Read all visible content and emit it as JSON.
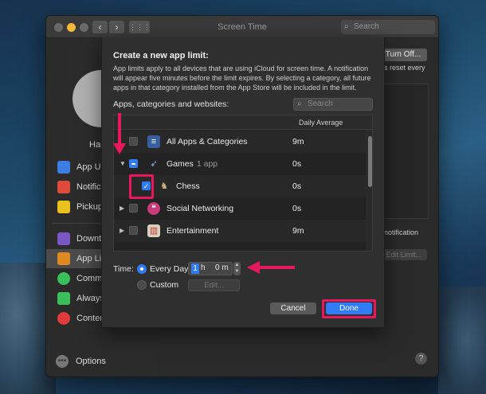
{
  "window": {
    "title": "Screen Time",
    "search_placeholder": "Search",
    "nav_back": "‹",
    "nav_fwd": "›",
    "grid": "⋮⋮⋮"
  },
  "sidebar": {
    "user_name": "Har",
    "items": [
      {
        "label": "App Us",
        "icon": "app-usage-icon",
        "color": "#3b7de0"
      },
      {
        "label": "Notific",
        "icon": "notifications-icon",
        "color": "#e04a3b"
      },
      {
        "label": "Pickup",
        "icon": "pickups-icon",
        "color": "#e8c21f"
      },
      {
        "label": "Downti",
        "icon": "downtime-icon",
        "color": "#7a58c4"
      },
      {
        "label": "App Li",
        "icon": "app-limits-icon",
        "color": "#e08a1f"
      },
      {
        "label": "Comm",
        "icon": "communication-icon",
        "color": "#3bbf5a"
      },
      {
        "label": "Always",
        "icon": "always-allowed-icon",
        "color": "#3bbf5a"
      },
      {
        "label": "Conter",
        "icon": "content-privacy-icon",
        "color": "#e03b3b"
      }
    ],
    "options_label": "Options"
  },
  "right": {
    "turn_off": "Turn Off...",
    "reset_text": "s reset every",
    "notification_text": "notification",
    "edit_limit": "Edit Limit..."
  },
  "sheet": {
    "title": "Create a new app limit:",
    "description": "App limits apply to all devices that are using iCloud for screen time. A notification will appear five minutes before the limit expires. By selecting a category, all future apps in that category installed from the App Store will be included in the limit.",
    "list_label": "Apps, categories and websites:",
    "search_placeholder": "Search",
    "column_daily": "Daily Average",
    "rows": [
      {
        "name": "All Apps & Categories",
        "sub": "",
        "time": "9m",
        "icon": "stack-icon",
        "check": "none",
        "disclosure": ""
      },
      {
        "name": "Games",
        "sub": "1 app",
        "time": "0s",
        "icon": "rocket-icon",
        "check": "mixed",
        "disclosure": "▼"
      },
      {
        "name": "Chess",
        "sub": "",
        "time": "0s",
        "icon": "chess-icon",
        "check": "checked",
        "disclosure": ""
      },
      {
        "name": "Social Networking",
        "sub": "",
        "time": "0s",
        "icon": "chat-bubble-icon",
        "check": "none",
        "disclosure": "▶"
      },
      {
        "name": "Entertainment",
        "sub": "",
        "time": "9m",
        "icon": "popcorn-icon",
        "check": "none",
        "disclosure": "▶"
      }
    ],
    "time_label": "Time:",
    "every_day_label": "Every Day",
    "custom_label": "Custom",
    "hours": "1",
    "hours_unit": "h",
    "minutes": "0 m",
    "edit_label": "Edit...",
    "cancel_label": "Cancel",
    "done_label": "Done"
  },
  "colors": {
    "accent": "#2f7cf6",
    "annotation": "#e8185c"
  }
}
